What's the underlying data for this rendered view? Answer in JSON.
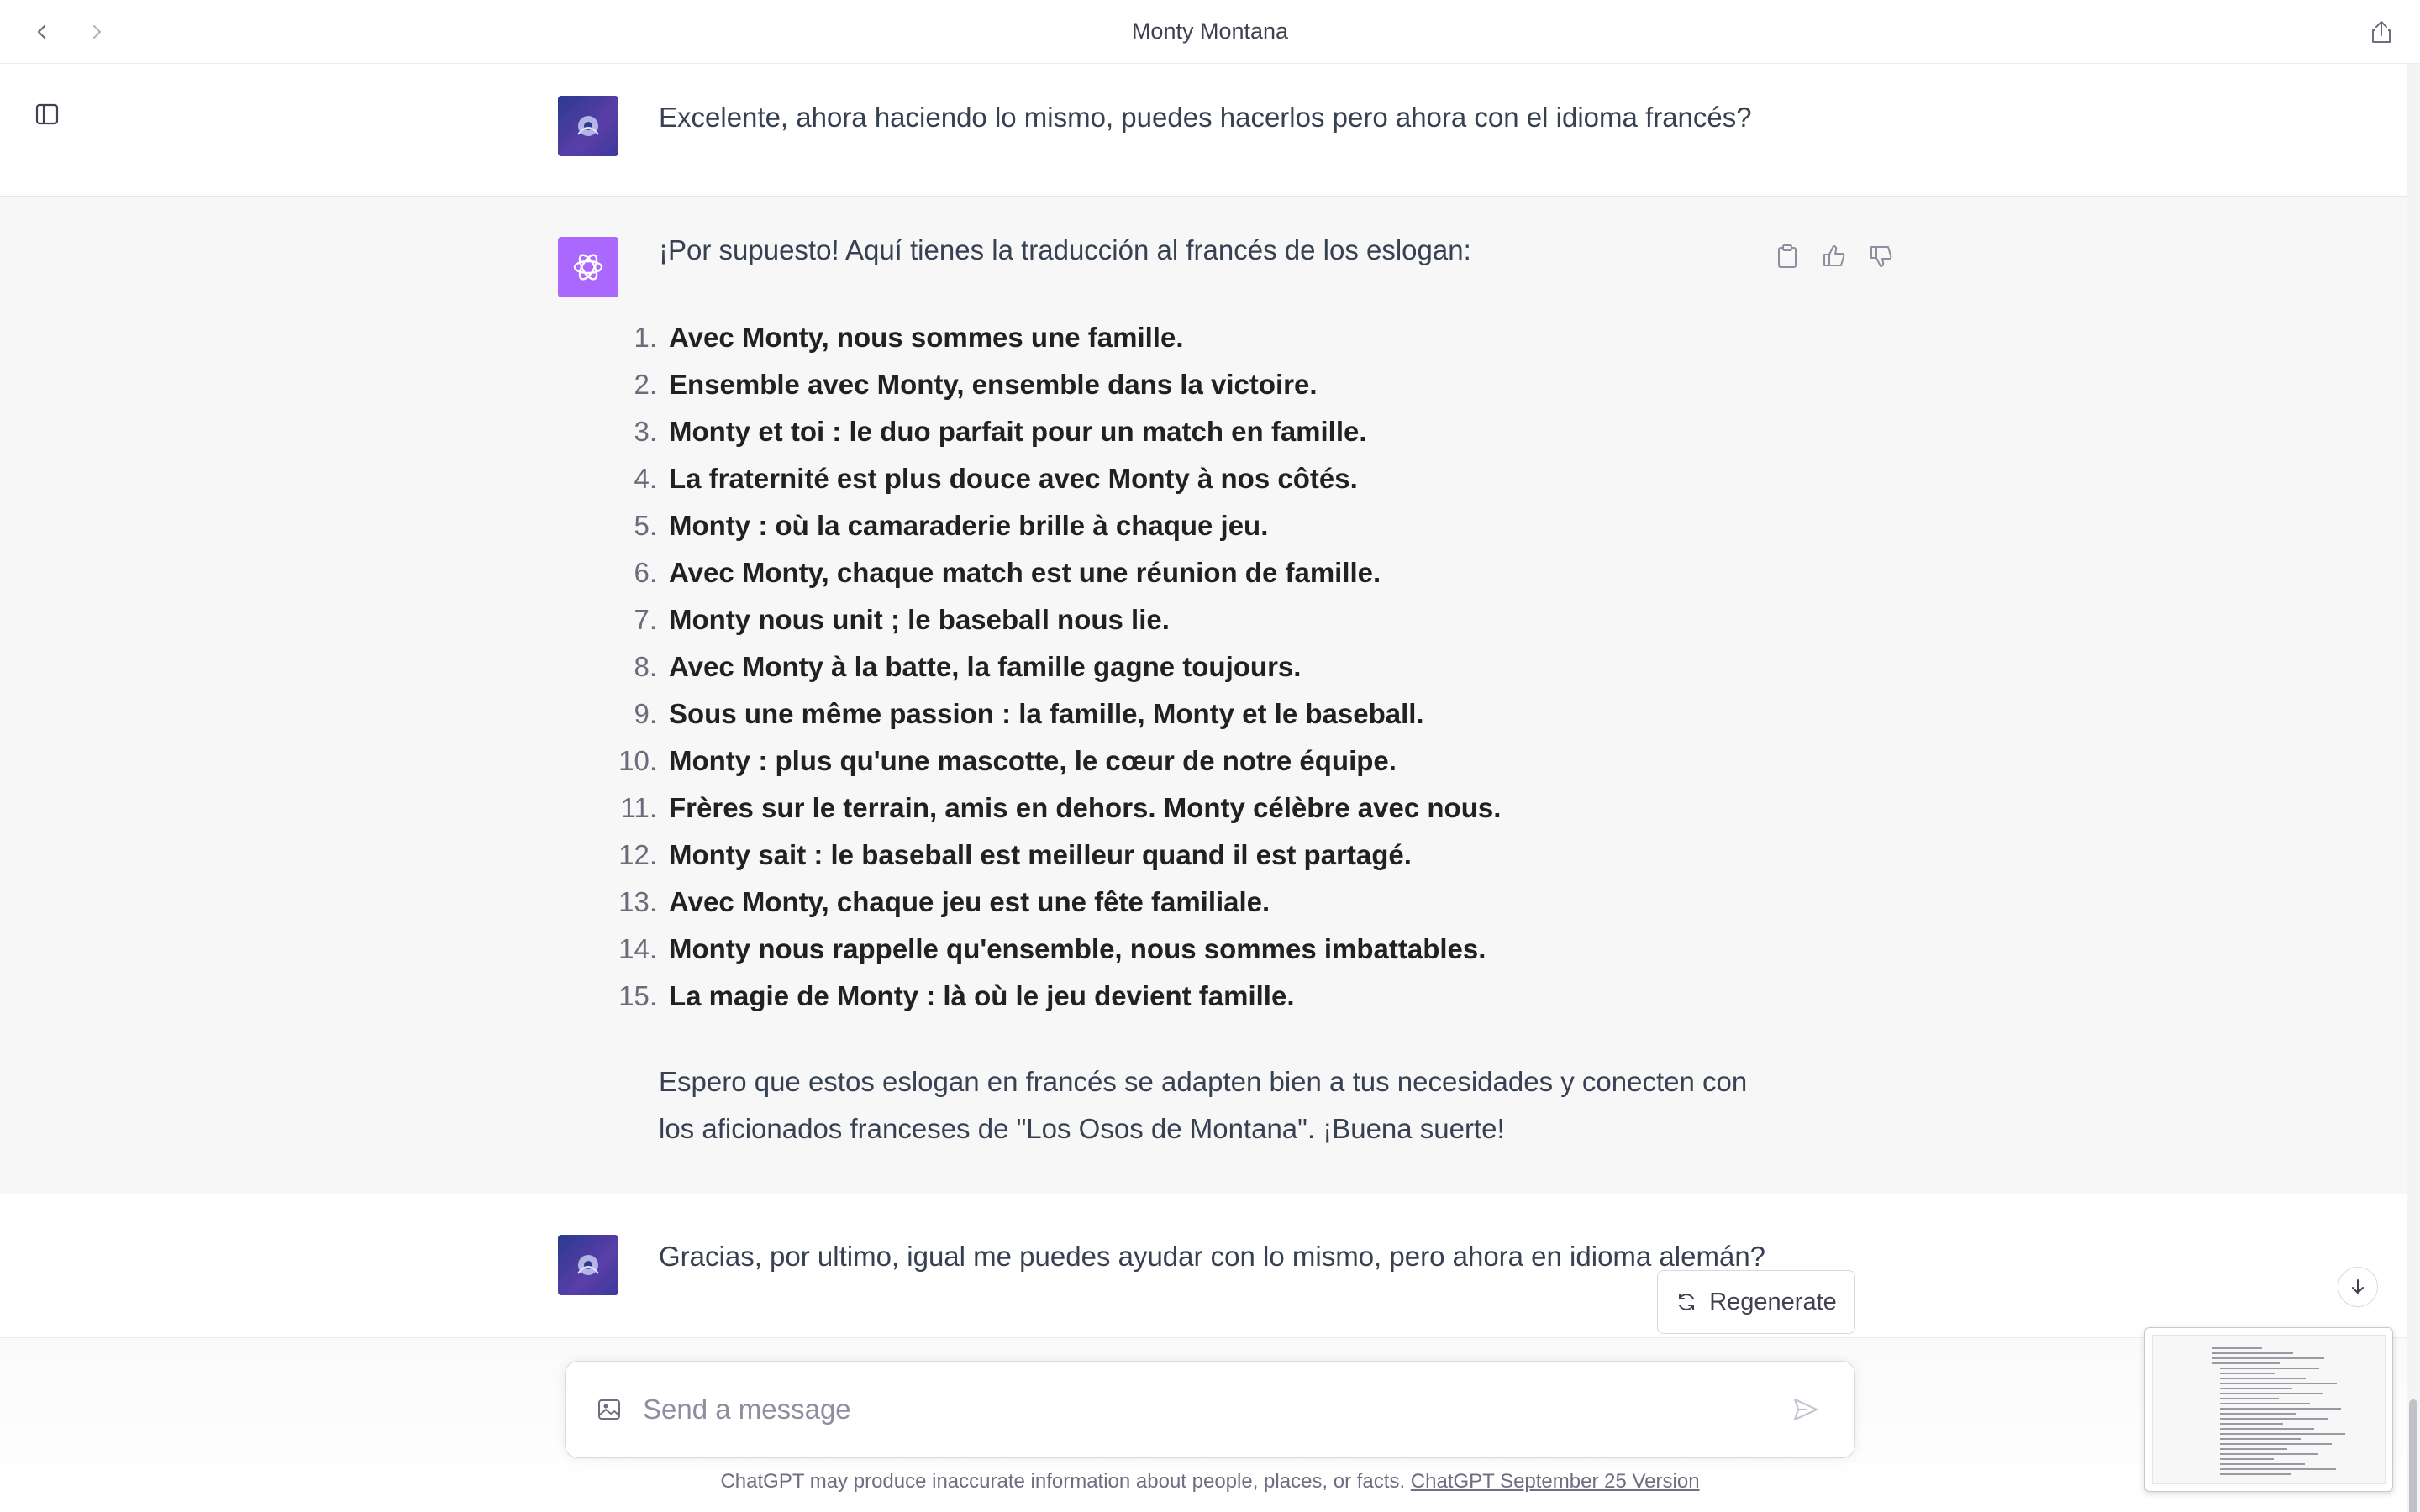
{
  "window": {
    "title": "Monty Montana"
  },
  "messages": {
    "user1": "Excelente, ahora haciendo lo mismo, puedes hacerlos pero ahora con el idioma francés?",
    "assistant": {
      "intro": "¡Por supuesto! Aquí tienes la traducción al francés de los eslogan:",
      "slogans": [
        {
          "num": "1.",
          "text": "Avec Monty, nous sommes une famille."
        },
        {
          "num": "2.",
          "text": "Ensemble avec Monty, ensemble dans la victoire."
        },
        {
          "num": "3.",
          "text": "Monty et toi : le duo parfait pour un match en famille."
        },
        {
          "num": "4.",
          "text": "La fraternité est plus douce avec Monty à nos côtés."
        },
        {
          "num": "5.",
          "text": "Monty : où la camaraderie brille à chaque jeu."
        },
        {
          "num": "6.",
          "text": "Avec Monty, chaque match est une réunion de famille."
        },
        {
          "num": "7.",
          "text": "Monty nous unit ; le baseball nous lie."
        },
        {
          "num": "8.",
          "text": "Avec Monty à la batte, la famille gagne toujours."
        },
        {
          "num": "9.",
          "text": "Sous une même passion : la famille, Monty et le baseball."
        },
        {
          "num": "10.",
          "text": "Monty : plus qu'une mascotte, le cœur de notre équipe."
        },
        {
          "num": "11.",
          "text": "Frères sur le terrain, amis en dehors. Monty célèbre avec nous."
        },
        {
          "num": "12.",
          "text": "Monty sait : le baseball est meilleur quand il est partagé."
        },
        {
          "num": "13.",
          "text": "Avec Monty, chaque jeu est une fête familiale."
        },
        {
          "num": "14.",
          "text": "Monty nous rappelle qu'ensemble, nous sommes imbattables."
        },
        {
          "num": "15.",
          "text": "La magie de Monty : là où le jeu devient famille."
        }
      ],
      "outro": "Espero que estos eslogan en francés se adapten bien a tus necesidades y conecten con los aficionados franceses de \"Los Osos de Montana\". ¡Buena suerte!"
    },
    "user2": "Gracias, por ultimo, igual me puedes ayudar con lo mismo, pero ahora en idioma alemán?"
  },
  "controls": {
    "regenerate_label": "Regenerate",
    "composer_placeholder": "Send a message"
  },
  "footer": {
    "disclaimer": "ChatGPT may produce inaccurate information about people, places, or facts.",
    "version_link": "ChatGPT September 25 Version"
  },
  "icons": {
    "back": "chevron-left-icon",
    "forward": "chevron-right-icon",
    "share": "share-icon",
    "sidebar": "sidebar-toggle-icon",
    "copy": "clipboard-icon",
    "like": "thumbs-up-icon",
    "dislike": "thumbs-down-icon",
    "regenerate": "refresh-icon",
    "image": "image-icon",
    "send": "send-icon",
    "scroll": "arrow-down-icon"
  },
  "colors": {
    "assistant_bg": "#f7f7f8",
    "gpt_avatar": "#ab68ff",
    "text": "#374151"
  }
}
